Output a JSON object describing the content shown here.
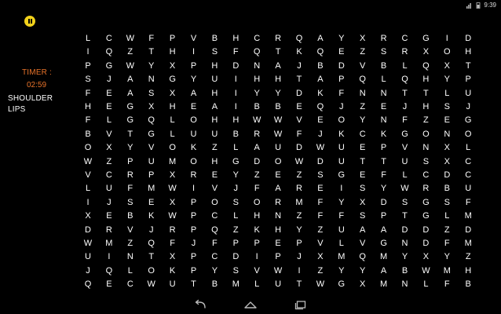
{
  "status_bar": {
    "time": "9:39"
  },
  "game": {
    "timer_label": "TIMER :",
    "timer_value": "02:59",
    "words": [
      "SHOULDER",
      "LIPS"
    ],
    "grid": [
      [
        "L",
        "C",
        "W",
        "F",
        "P",
        "V",
        "B",
        "H",
        "C",
        "R",
        "Q",
        "A",
        "Y",
        "X",
        "R",
        "C",
        "G",
        "I",
        "D"
      ],
      [
        "I",
        "Q",
        "Z",
        "T",
        "H",
        "I",
        "S",
        "F",
        "Q",
        "T",
        "K",
        "Q",
        "E",
        "Z",
        "S",
        "R",
        "X",
        "O",
        "H"
      ],
      [
        "P",
        "G",
        "W",
        "Y",
        "X",
        "P",
        "H",
        "D",
        "N",
        "A",
        "J",
        "B",
        "D",
        "V",
        "B",
        "L",
        "Q",
        "X",
        "T"
      ],
      [
        "S",
        "J",
        "A",
        "N",
        "G",
        "Y",
        "U",
        "I",
        "H",
        "H",
        "T",
        "A",
        "P",
        "Q",
        "L",
        "Q",
        "H",
        "Y",
        "P"
      ],
      [
        "F",
        "E",
        "A",
        "S",
        "X",
        "A",
        "H",
        "I",
        "Y",
        "Y",
        "D",
        "K",
        "F",
        "N",
        "N",
        "T",
        "T",
        "L",
        "U"
      ],
      [
        "H",
        "E",
        "G",
        "X",
        "H",
        "E",
        "A",
        "I",
        "B",
        "B",
        "E",
        "Q",
        "J",
        "Z",
        "E",
        "J",
        "H",
        "S",
        "J"
      ],
      [
        "F",
        "L",
        "G",
        "Q",
        "L",
        "O",
        "H",
        "H",
        "W",
        "W",
        "V",
        "E",
        "O",
        "Y",
        "N",
        "F",
        "Z",
        "E",
        "G"
      ],
      [
        "B",
        "V",
        "T",
        "G",
        "L",
        "U",
        "U",
        "B",
        "R",
        "W",
        "F",
        "J",
        "K",
        "C",
        "K",
        "G",
        "O",
        "N",
        "O"
      ],
      [
        "O",
        "X",
        "Y",
        "V",
        "O",
        "K",
        "Z",
        "L",
        "A",
        "U",
        "D",
        "W",
        "U",
        "E",
        "P",
        "V",
        "N",
        "X",
        "L"
      ],
      [
        "W",
        "Z",
        "P",
        "U",
        "M",
        "O",
        "H",
        "G",
        "D",
        "O",
        "W",
        "D",
        "U",
        "T",
        "T",
        "U",
        "S",
        "X",
        "C"
      ],
      [
        "V",
        "C",
        "R",
        "P",
        "X",
        "R",
        "E",
        "Y",
        "Z",
        "E",
        "Z",
        "S",
        "G",
        "E",
        "F",
        "L",
        "C",
        "D",
        "C"
      ],
      [
        "L",
        "U",
        "F",
        "M",
        "W",
        "I",
        "V",
        "J",
        "F",
        "A",
        "R",
        "E",
        "I",
        "S",
        "Y",
        "W",
        "R",
        "B",
        "U"
      ],
      [
        "I",
        "J",
        "S",
        "E",
        "X",
        "P",
        "O",
        "S",
        "O",
        "R",
        "M",
        "F",
        "Y",
        "X",
        "D",
        "S",
        "G",
        "S",
        "F"
      ],
      [
        "X",
        "E",
        "B",
        "K",
        "W",
        "P",
        "C",
        "L",
        "H",
        "N",
        "Z",
        "F",
        "F",
        "S",
        "P",
        "T",
        "G",
        "L",
        "M"
      ],
      [
        "D",
        "R",
        "V",
        "J",
        "R",
        "P",
        "Q",
        "Z",
        "K",
        "H",
        "Y",
        "Z",
        "U",
        "A",
        "A",
        "D",
        "D",
        "Z",
        "D"
      ],
      [
        "W",
        "M",
        "Z",
        "Q",
        "F",
        "J",
        "F",
        "P",
        "P",
        "E",
        "P",
        "V",
        "L",
        "V",
        "G",
        "N",
        "D",
        "F",
        "M"
      ],
      [
        "U",
        "I",
        "N",
        "T",
        "X",
        "P",
        "C",
        "D",
        "I",
        "P",
        "J",
        "X",
        "M",
        "Q",
        "M",
        "Y",
        "X",
        "Y",
        "Z"
      ],
      [
        "J",
        "Q",
        "L",
        "O",
        "K",
        "P",
        "Y",
        "S",
        "V",
        "W",
        "I",
        "Z",
        "Y",
        "Y",
        "A",
        "B",
        "W",
        "M",
        "H"
      ],
      [
        "Q",
        "E",
        "C",
        "W",
        "U",
        "T",
        "B",
        "M",
        "L",
        "U",
        "T",
        "W",
        "G",
        "X",
        "M",
        "N",
        "L",
        "F",
        "B"
      ]
    ]
  },
  "icons": {
    "pause": "pause-icon",
    "back": "back-icon",
    "home": "home-icon",
    "recents": "recents-icon"
  },
  "colors": {
    "accent_timer": "#e8732a",
    "pause_button": "#f2d21b",
    "background": "#000000",
    "text": "#ffffff"
  }
}
